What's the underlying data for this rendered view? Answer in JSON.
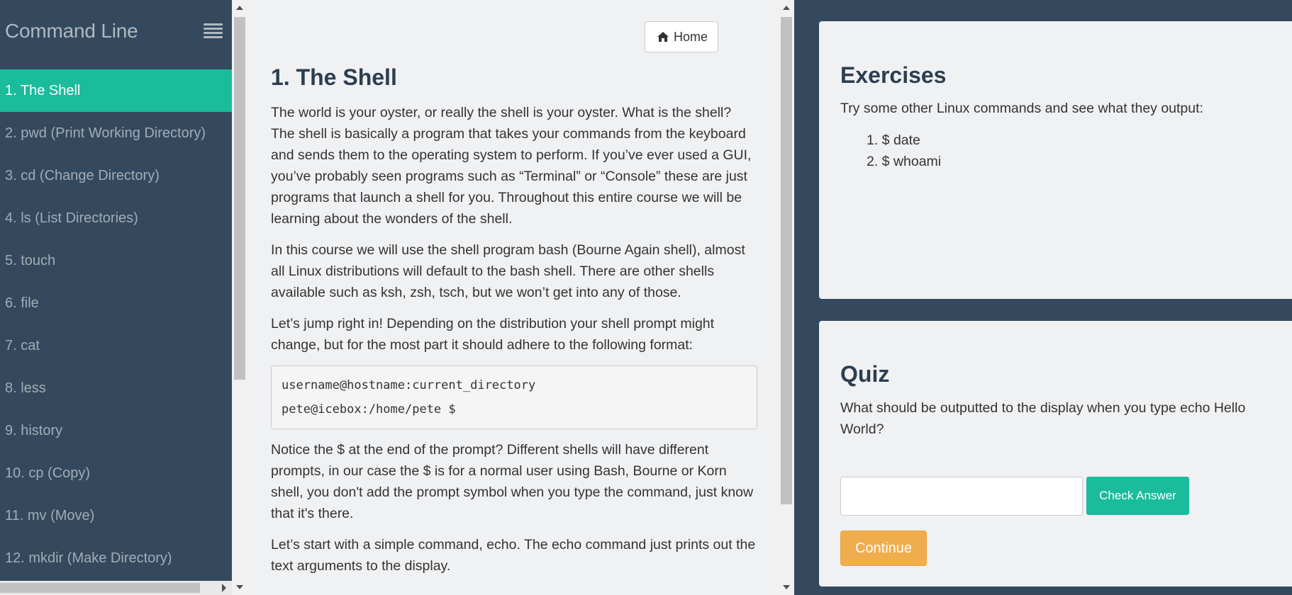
{
  "sidebar": {
    "title": "Command Line",
    "items": [
      {
        "label": "1. The Shell"
      },
      {
        "label": "2. pwd (Print Working Directory)"
      },
      {
        "label": "3. cd (Change Directory)"
      },
      {
        "label": "4. ls (List Directories)"
      },
      {
        "label": "5. touch"
      },
      {
        "label": "6. file"
      },
      {
        "label": "7. cat"
      },
      {
        "label": "8. less"
      },
      {
        "label": "9. history"
      },
      {
        "label": "10. cp (Copy)"
      },
      {
        "label": "11. mv (Move)"
      },
      {
        "label": "12. mkdir (Make Directory)"
      }
    ],
    "active_index": 0
  },
  "lesson": {
    "home_label": "Home",
    "title": "1. The Shell",
    "paragraphs": [
      "The world is your oyster, or really the shell is your oyster. What is the shell? The shell is basically a program that takes your commands from the keyboard and sends them to the operating system to perform. If you’ve ever used a GUI, you’ve probably seen programs such as “Terminal” or “Console” these are just programs that launch a shell for you. Throughout this entire course we will be learning about the wonders of the shell.",
      "In this course we will use the shell program bash (Bourne Again shell), almost all Linux distributions will default to the bash shell. There are other shells available such as ksh, zsh, tsch, but we won’t get into any of those.",
      "Let’s jump right in! Depending on the distribution your shell prompt might change, but for the most part it should adhere to the following format:",
      "Notice the $ at the end of the prompt? Different shells will have different prompts, in our case the $ is for a normal user using Bash, Bourne or Korn shell, you don't add the prompt symbol when you type the command, just know that it's there.",
      "Let’s start with a simple command, echo. The echo command just prints out the text arguments to the display."
    ],
    "code_lines": [
      "username@hostname:current_directory",
      "pete@icebox:/home/pete $"
    ]
  },
  "exercises": {
    "title": "Exercises",
    "intro": "Try some other Linux commands and see what they output:",
    "items": [
      "1. $ date",
      "2. $ whoami"
    ]
  },
  "quiz": {
    "title": "Quiz",
    "question": "What should be outputted to the display when you type echo Hello World?",
    "input_value": "",
    "check_label": "Check Answer",
    "continue_label": "Continue"
  },
  "colors": {
    "sidebar_bg": "#34495e",
    "accent": "#1abc9c",
    "warning": "#f0ad4e"
  }
}
